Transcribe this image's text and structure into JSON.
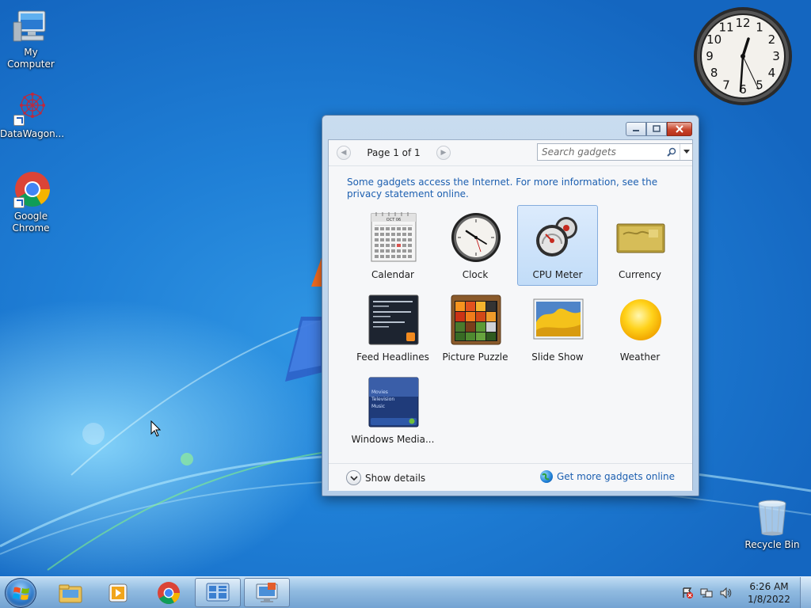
{
  "desktop": {
    "icons": [
      {
        "label": "My Computer",
        "icon": "computer-icon"
      },
      {
        "label": "DataWagon...",
        "icon": "datawagon-icon"
      },
      {
        "label": "Google Chrome",
        "icon": "chrome-icon"
      },
      {
        "label": "Recycle Bin",
        "icon": "recycle-bin-icon"
      }
    ]
  },
  "clock_gadget": {
    "numerals": [
      "12",
      "1",
      "2",
      "3",
      "4",
      "5",
      "6",
      "7",
      "8",
      "9",
      "10",
      "11"
    ]
  },
  "gadget_window": {
    "pager_label": "Page 1 of 1",
    "search_placeholder": "Search gadgets",
    "privacy_text": "Some gadgets access the Internet.  For more information, see the privacy statement online.",
    "gadgets": [
      {
        "label": "Calendar",
        "icon": "calendar-icon",
        "selected": false
      },
      {
        "label": "Clock",
        "icon": "clock-icon",
        "selected": false
      },
      {
        "label": "CPU Meter",
        "icon": "cpu-meter-icon",
        "selected": true
      },
      {
        "label": "Currency",
        "icon": "currency-icon",
        "selected": false
      },
      {
        "label": "Feed Headlines",
        "icon": "feed-headlines-icon",
        "selected": false
      },
      {
        "label": "Picture Puzzle",
        "icon": "picture-puzzle-icon",
        "selected": false
      },
      {
        "label": "Slide Show",
        "icon": "slide-show-icon",
        "selected": false
      },
      {
        "label": "Weather",
        "icon": "weather-icon",
        "selected": false
      },
      {
        "label": "Windows Media...",
        "icon": "windows-media-center-icon",
        "selected": false
      }
    ],
    "calendar_thumb_month": "OCT 06",
    "media_thumb_items": [
      "Movies",
      "Television",
      "Music"
    ],
    "show_details_label": "Show details",
    "get_more_label": "Get more gadgets online"
  },
  "taskbar": {
    "time": "6:26 AM",
    "date": "1/8/2022",
    "pinned": [
      "explorer-icon",
      "media-player-icon",
      "chrome-icon",
      "gadgets-icon",
      "display-icon"
    ]
  },
  "colors": {
    "link_blue": "#1c5fb0",
    "desktop_blue": "#1f7fd6",
    "selected_bg": "#c1dcf8"
  }
}
